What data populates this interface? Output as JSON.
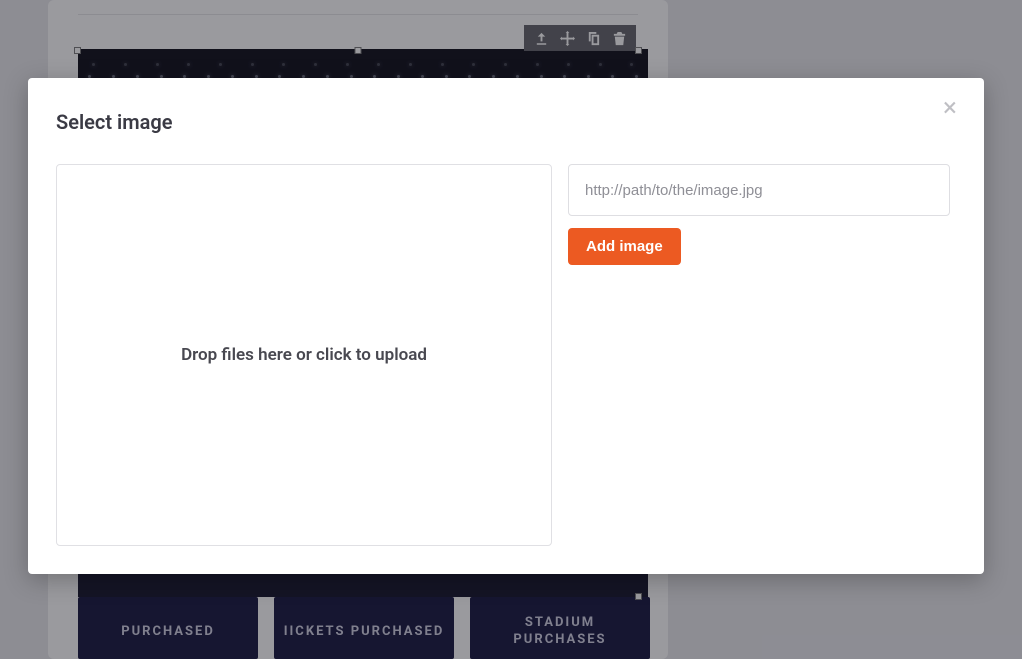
{
  "modal": {
    "title": "Select image",
    "dropzone_text": "Drop files here or click to upload",
    "url_placeholder": "http://path/to/the/image.jpg",
    "add_button_label": "Add image"
  },
  "toolbar": {
    "icons": [
      "upload-icon",
      "move-icon",
      "copy-icon",
      "trash-icon"
    ]
  },
  "background": {
    "buttons": [
      "PURCHASED",
      "IICKETS PURCHASED",
      "STADIUM PURCHASES"
    ]
  }
}
